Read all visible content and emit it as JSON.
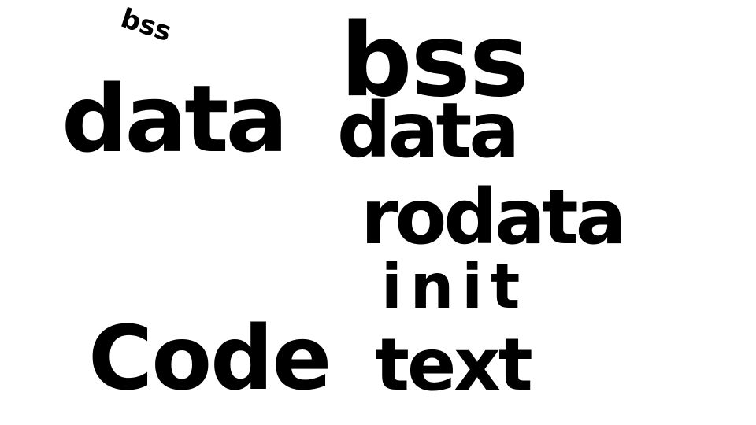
{
  "left_column": {
    "scribble": "bss",
    "data": "data",
    "code": "Code"
  },
  "right_column": {
    "bss": "bss",
    "data": "data",
    "rodata": "rodata",
    "init": "init",
    "text": "text"
  },
  "colors": {
    "ink": "#000000",
    "background": "#ffffff"
  }
}
